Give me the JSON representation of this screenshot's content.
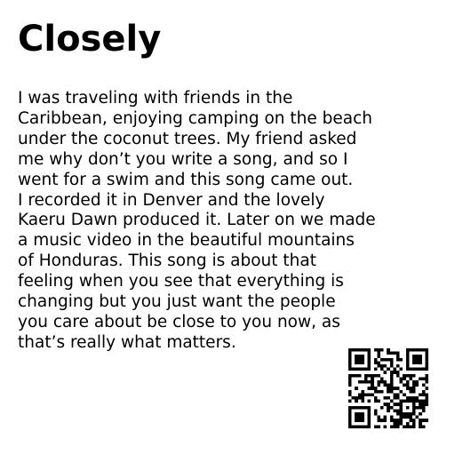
{
  "title": "Closely",
  "body_lines": [
    "I was traveling with friends in the",
    "Caribbean, enjoying camping on the beach",
    "under the coconut trees. My friend asked",
    "me why don’t you write a song, and so I",
    "went for a swim and this song came out.",
    "I recorded it in Denver and the lovely",
    "Kaeru Dawn produced it. Later on we made",
    "a music video in the beautiful mountains",
    "of Honduras. This song is about that",
    "feeling when you see that everything is",
    "changing but you just want the people",
    "you care about be close to you now, as",
    "that’s really what matters."
  ],
  "qr": {
    "icon": "qr-code-icon",
    "color": "#000000"
  }
}
